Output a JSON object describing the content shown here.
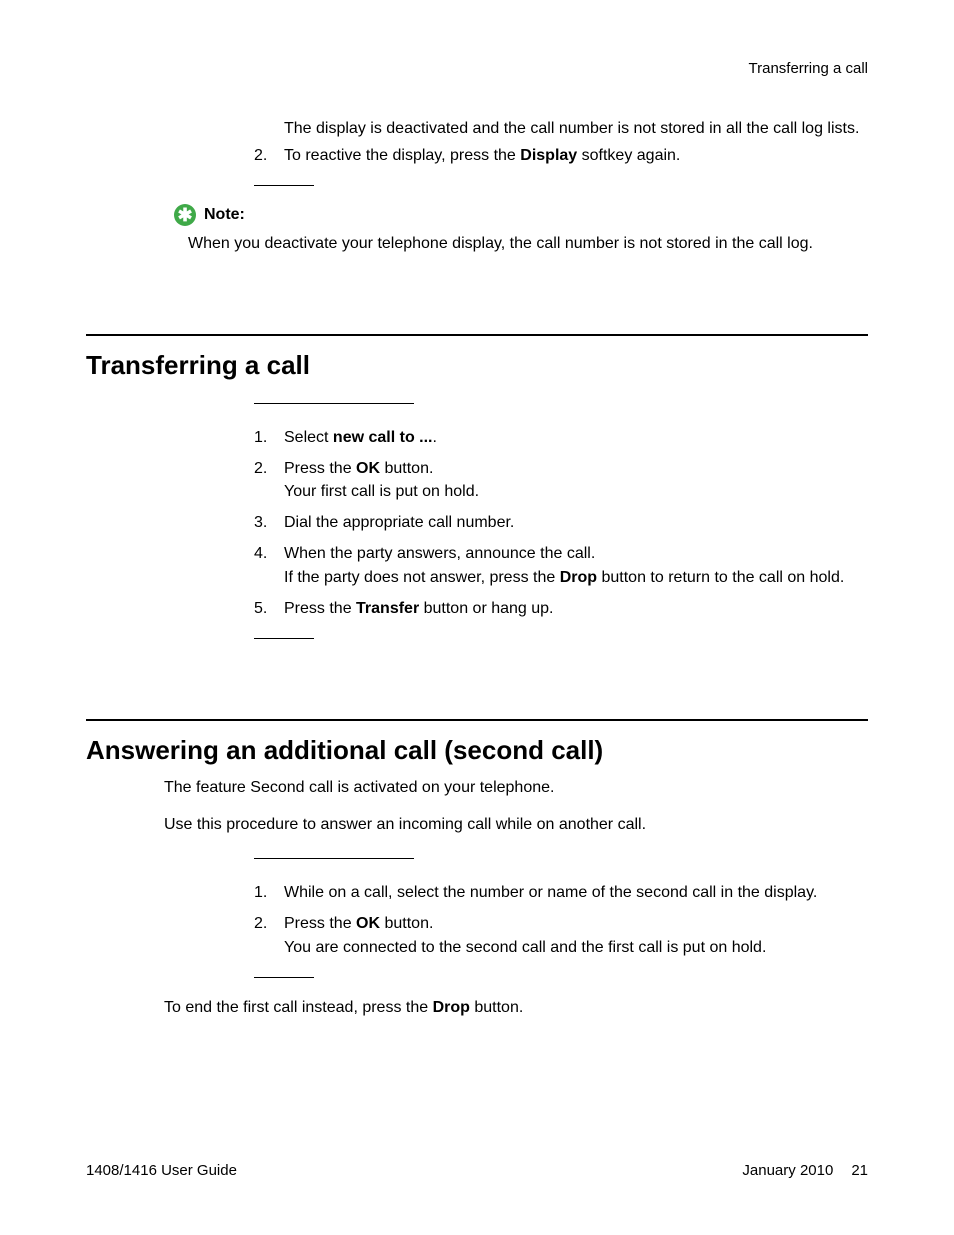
{
  "header": {
    "breadcrumb": "Transferring a call"
  },
  "top_block": {
    "continuation_text": "The display is deactivated and the call number is not stored in all the call log lists.",
    "step2_pre": "To reactive the display, press the ",
    "step2_bold": "Display",
    "step2_post": " softkey again."
  },
  "note": {
    "icon_glyph": "✱",
    "label": "Note:",
    "text": "When you deactivate your telephone display, the call number is not stored in the call log."
  },
  "section1": {
    "title": "Transferring a call",
    "steps": {
      "s1_pre": "Select ",
      "s1_bold": "new call to ...",
      "s1_post": ".",
      "s2_pre": "Press the ",
      "s2_bold": "OK",
      "s2_post": " button.",
      "s2_line2": "Your first call is put on hold.",
      "s3": "Dial the appropriate call number.",
      "s4_line1": "When the party answers, announce the call.",
      "s4_pre": "If the party does not answer, press the ",
      "s4_bold": "Drop",
      "s4_post": " button to return to the call on hold.",
      "s5_pre": "Press the ",
      "s5_bold": "Transfer",
      "s5_post": " button or hang up."
    }
  },
  "section2": {
    "title": "Answering an additional call (second call)",
    "intro1": "The feature Second call is activated on your telephone.",
    "intro2": "Use this procedure to answer an incoming call while on another call.",
    "steps": {
      "s1": "While on a call, select the number or name of the second call in the display.",
      "s2_pre": "Press the ",
      "s2_bold": "OK",
      "s2_post": " button.",
      "s2_line2": "You are connected to the second call and the first call is put on hold."
    },
    "end_pre": "To end the first call instead, press the ",
    "end_bold": "Drop",
    "end_post": " button."
  },
  "footer": {
    "left": "1408/1416 User Guide",
    "date": "January 2010",
    "page": "21"
  }
}
